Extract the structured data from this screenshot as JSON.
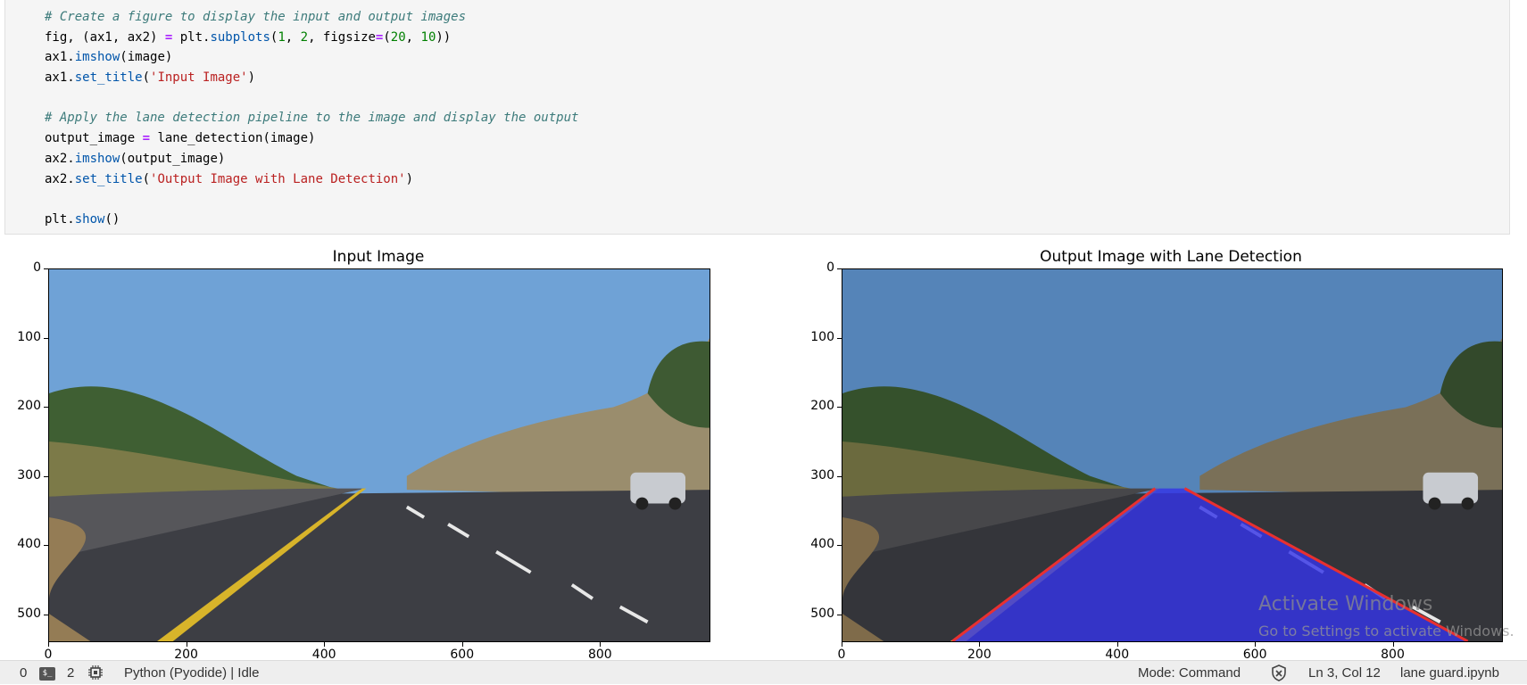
{
  "code_cell": {
    "lines": [
      [
        {
          "t": "# Create a figure to display the input and output images",
          "c": "c-com"
        }
      ],
      [
        {
          "t": "fig, (ax1, ax2) ",
          "c": ""
        },
        {
          "t": "=",
          "c": "c-op"
        },
        {
          "t": " plt.",
          "c": ""
        },
        {
          "t": "subplots",
          "c": "c-fn"
        },
        {
          "t": "(",
          "c": ""
        },
        {
          "t": "1",
          "c": "c-num"
        },
        {
          "t": ", ",
          "c": ""
        },
        {
          "t": "2",
          "c": "c-num"
        },
        {
          "t": ", figsize",
          "c": ""
        },
        {
          "t": "=",
          "c": "c-op"
        },
        {
          "t": "(",
          "c": ""
        },
        {
          "t": "20",
          "c": "c-num"
        },
        {
          "t": ", ",
          "c": ""
        },
        {
          "t": "10",
          "c": "c-num"
        },
        {
          "t": "))",
          "c": ""
        }
      ],
      [
        {
          "t": "ax1.",
          "c": ""
        },
        {
          "t": "imshow",
          "c": "c-fn"
        },
        {
          "t": "(image)",
          "c": ""
        }
      ],
      [
        {
          "t": "ax1.",
          "c": ""
        },
        {
          "t": "set_title",
          "c": "c-fn"
        },
        {
          "t": "(",
          "c": ""
        },
        {
          "t": "'Input Image'",
          "c": "c-str"
        },
        {
          "t": ")",
          "c": ""
        }
      ],
      [],
      [
        {
          "t": "# Apply the lane detection pipeline to the image and display the output",
          "c": "c-com"
        }
      ],
      [
        {
          "t": "output_image ",
          "c": ""
        },
        {
          "t": "=",
          "c": "c-op"
        },
        {
          "t": " lane_detection(image)",
          "c": ""
        }
      ],
      [
        {
          "t": "ax2.",
          "c": ""
        },
        {
          "t": "imshow",
          "c": "c-fn"
        },
        {
          "t": "(output_image)",
          "c": ""
        }
      ],
      [
        {
          "t": "ax2.",
          "c": ""
        },
        {
          "t": "set_title",
          "c": "c-fn"
        },
        {
          "t": "(",
          "c": ""
        },
        {
          "t": "'Output Image with Lane Detection'",
          "c": "c-str"
        },
        {
          "t": ")",
          "c": ""
        }
      ],
      [],
      [
        {
          "t": "plt.",
          "c": ""
        },
        {
          "t": "show",
          "c": "c-fn"
        },
        {
          "t": "()",
          "c": ""
        }
      ]
    ]
  },
  "plots": [
    {
      "title": "Input Image",
      "xticks": [
        "0",
        "200",
        "400",
        "600",
        "800"
      ],
      "yticks": [
        "0",
        "100",
        "200",
        "300",
        "400",
        "500"
      ],
      "lane_overlay": false
    },
    {
      "title": "Output Image with Lane Detection",
      "xticks": [
        "0",
        "200",
        "400",
        "600",
        "800"
      ],
      "yticks": [
        "0",
        "100",
        "200",
        "300",
        "400",
        "500"
      ],
      "lane_overlay": true
    }
  ],
  "watermark": {
    "line1": "Activate Windows",
    "line2": "Go to Settings to activate Windows."
  },
  "statusbar": {
    "count_left": "0",
    "terminal_icon": "terminal-icon",
    "count_terminals": "2",
    "kernel_icon": "kernel-chip-icon",
    "kernel_status": "Python (Pyodide) | Idle",
    "mode": "Mode: Command",
    "notification_icon": "shield-icon",
    "cursor_position": "Ln 3, Col 12",
    "file_name": "lane guard.ipynb"
  },
  "colors": {
    "lane_fill": "#3535e6",
    "lane_edge": "#e83030",
    "sky": "#6fa2d6",
    "road": "#3d3e44"
  }
}
